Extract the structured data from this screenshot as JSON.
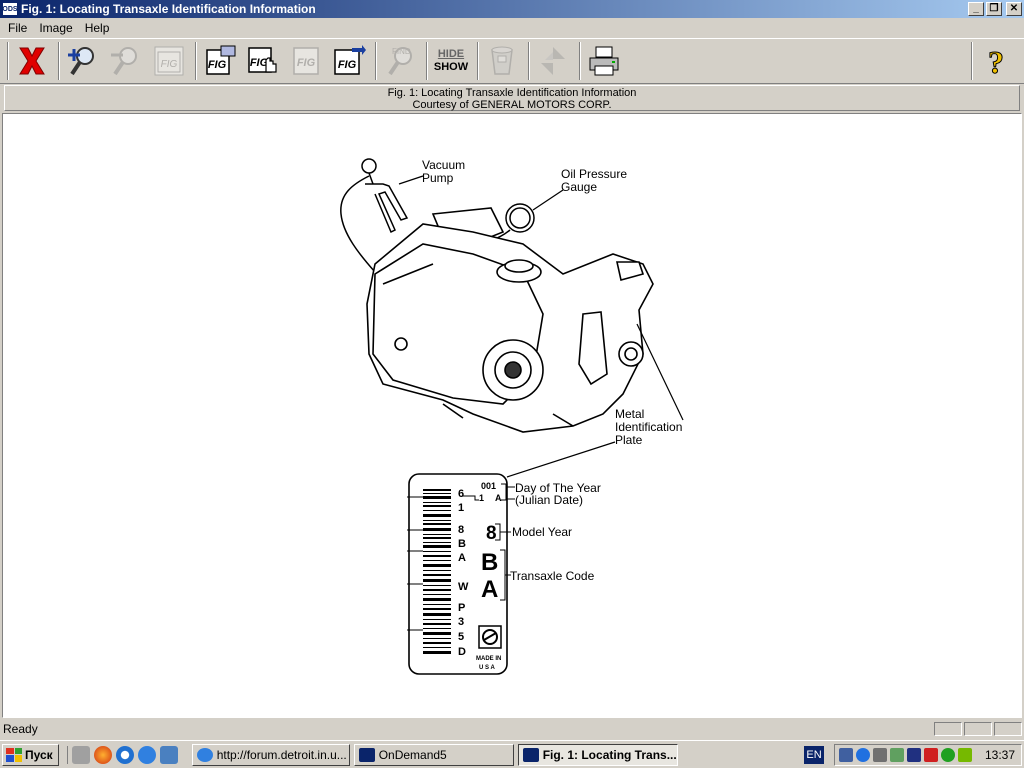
{
  "window": {
    "app_icon": "ODS",
    "title": "Fig. 1: Locating Transaxle Identification Information"
  },
  "menu": [
    "File",
    "Image",
    "Help"
  ],
  "toolbar": {
    "hide_label": "HIDE",
    "show_label": "SHOW"
  },
  "caption": {
    "line1": "Fig. 1: Locating Transaxle Identification Information",
    "line2": "Courtesy of GENERAL MOTORS CORP."
  },
  "figure": {
    "vacuum_pump_1": "Vacuum",
    "vacuum_pump_2": "Pump",
    "oil_pressure_1": "Oil Pressure",
    "oil_pressure_2": "Gauge",
    "metal_plate_1": "Metal",
    "metal_plate_2": "Identification",
    "metal_plate_3": "Plate",
    "day_of_year": "Day of The Year",
    "julian_date": "(Julian Date)",
    "model_year": "Model Year",
    "transaxle_code": "Transaxle Code",
    "plate_digits": [
      "6",
      "1",
      "8",
      "B",
      "A",
      "W",
      "P",
      "3",
      "5",
      "D"
    ],
    "plate_001": "001",
    "plate_1a_1": "1",
    "plate_1a_2": "A",
    "plate_big_8": "8",
    "plate_big_b": "B",
    "plate_big_a": "A",
    "made_in": "MADE IN",
    "usa": "U S A"
  },
  "status": {
    "text": "Ready"
  },
  "taskbar": {
    "start_label": "Пуск",
    "tasks": [
      {
        "label": "http://forum.detroit.in.u...",
        "active": false
      },
      {
        "label": "OnDemand5",
        "active": false
      },
      {
        "label": "Fig. 1: Locating Trans...",
        "active": true
      }
    ],
    "language": "EN",
    "clock": "13:37"
  },
  "colors": {
    "title_start": "#0a246a",
    "title_end": "#a6caf0",
    "close_red": "#e00000",
    "face": "#d4d0c8"
  }
}
